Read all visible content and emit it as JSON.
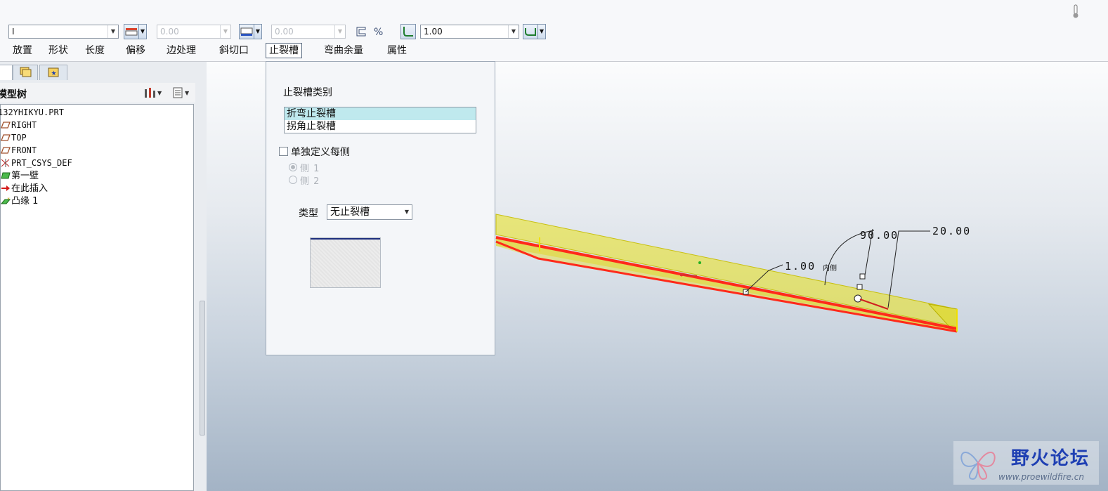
{
  "toolbar": {
    "combo_main": "I",
    "combo_width_value": "0.00",
    "combo_offset_value": "0.00",
    "combo_radius_value": "1.00"
  },
  "tabs": [
    "放置",
    "形状",
    "长度",
    "偏移",
    "边处理",
    "斜切口",
    "止裂槽",
    "弯曲余量",
    "属性"
  ],
  "active_tab": "止裂槽",
  "model_tree": {
    "title": "模型树",
    "items": [
      {
        "label": "132YHIKYU.PRT",
        "icon": "part-icon"
      },
      {
        "label": "RIGHT",
        "icon": "datum-plane-icon"
      },
      {
        "label": "TOP",
        "icon": "datum-plane-icon"
      },
      {
        "label": "FRONT",
        "icon": "datum-plane-icon"
      },
      {
        "label": "PRT_CSYS_DEF",
        "icon": "csys-icon"
      },
      {
        "label": "第一壁",
        "icon": "wall-icon"
      },
      {
        "label": "在此插入",
        "icon": "insert-arrow-icon"
      },
      {
        "label": "凸缘 1",
        "icon": "flange-icon"
      }
    ]
  },
  "relief_panel": {
    "category_label": "止裂槽类别",
    "categories": [
      "折弯止裂槽",
      "拐角止裂槽"
    ],
    "selected_category": "折弯止裂槽",
    "define_each_side_label": "单独定义每侧",
    "side1_label": "侧 1",
    "side2_label": "侧 2",
    "type_label": "类型",
    "type_value": "无止裂槽"
  },
  "dimensions": {
    "thickness": "1.00",
    "thickness_side": "内侧",
    "angle": "90.00",
    "length": "20.00"
  },
  "watermark": {
    "title": "野火论坛",
    "url": "www.proewildfire.cn"
  },
  "colors": {
    "wall_fill": "#e9e11a",
    "edge_highlight": "#ff2a1a",
    "active_tab_border": "#5a6b80",
    "list_selection": "#bfe9ee"
  }
}
